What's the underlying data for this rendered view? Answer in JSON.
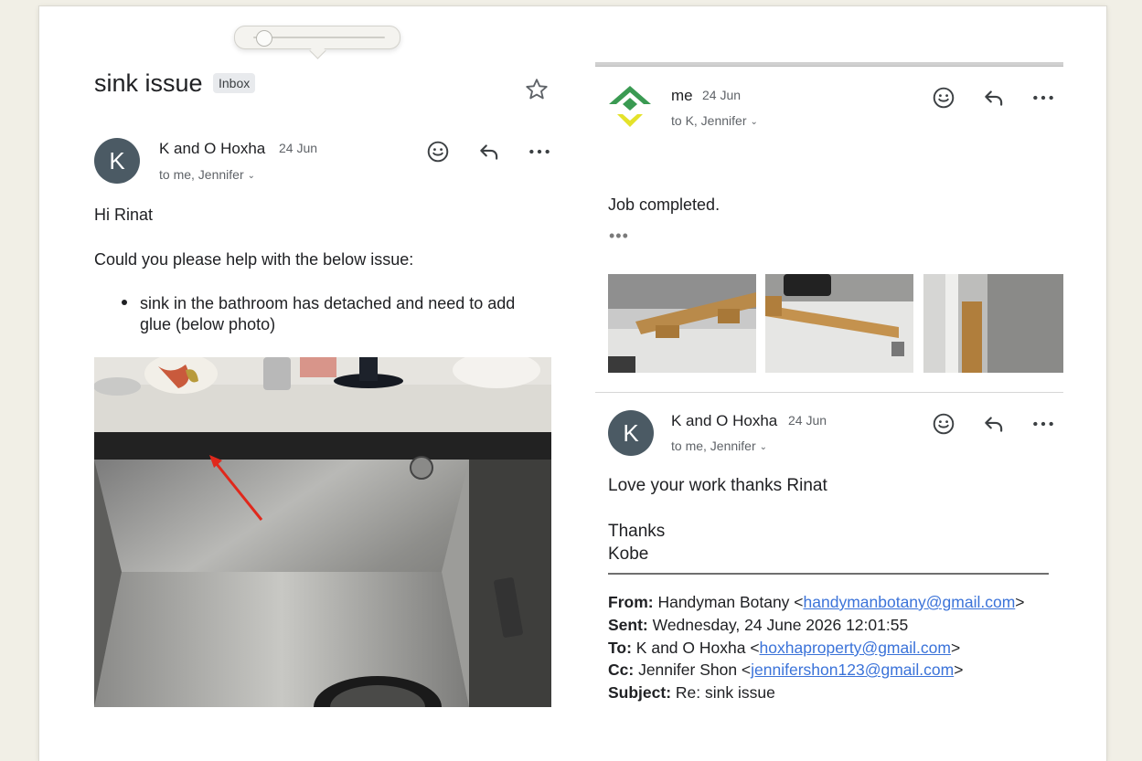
{
  "zoom_slider": {
    "level": 0.05
  },
  "thread": {
    "subject": "sink issue",
    "label": "Inbox"
  },
  "message1": {
    "avatar_letter": "K",
    "sender": "K and O Hoxha",
    "date": "24 Jun",
    "recipients": "to me, Jennifer",
    "greeting": "Hi Rinat",
    "intro": "Could you please help with the below issue:",
    "bullet_line1": "sink in the bathroom has detached and need to add",
    "bullet_line2": "glue (below photo)"
  },
  "message2": {
    "sender": "me",
    "date": "24 Jun",
    "recipients": "to K, Jennifer",
    "body": "Job completed.",
    "trimmed": "•••"
  },
  "message3": {
    "avatar_letter": "K",
    "sender": "K and O Hoxha",
    "date": "24 Jun",
    "recipients": "to me, Jennifer",
    "body": "Love your work thanks Rinat",
    "sign1": "Thanks",
    "sign2": "Kobe"
  },
  "quoted": {
    "from_label": "From:",
    "from_name": "Handyman Botany <",
    "from_email": "handymanbotany@gmail.com",
    "from_end": ">",
    "sent_label": "Sent:",
    "sent_value": "Wednesday, 24 June 2026 12:01:55",
    "to_label": "To:",
    "to_name": "K and O Hoxha <",
    "to_email": "hoxhaproperty@gmail.com",
    "to_end": ">",
    "cc_label": "Cc:",
    "cc_name": "Jennifer Shon <",
    "cc_email": "jennifershon123@gmail.com",
    "cc_end": ">",
    "subject_label": "Subject:",
    "subject_value": "Re: sink issue"
  },
  "colors": {
    "avatar": "#4b5a64",
    "link": "#3b73d9",
    "logo_green": "#3a9a52",
    "logo_yellow": "#e4e22a"
  },
  "icons": [
    "star-icon",
    "emoji-icon",
    "reply-icon",
    "more-icon",
    "chevron-down-icon",
    "company-logo-icon"
  ]
}
